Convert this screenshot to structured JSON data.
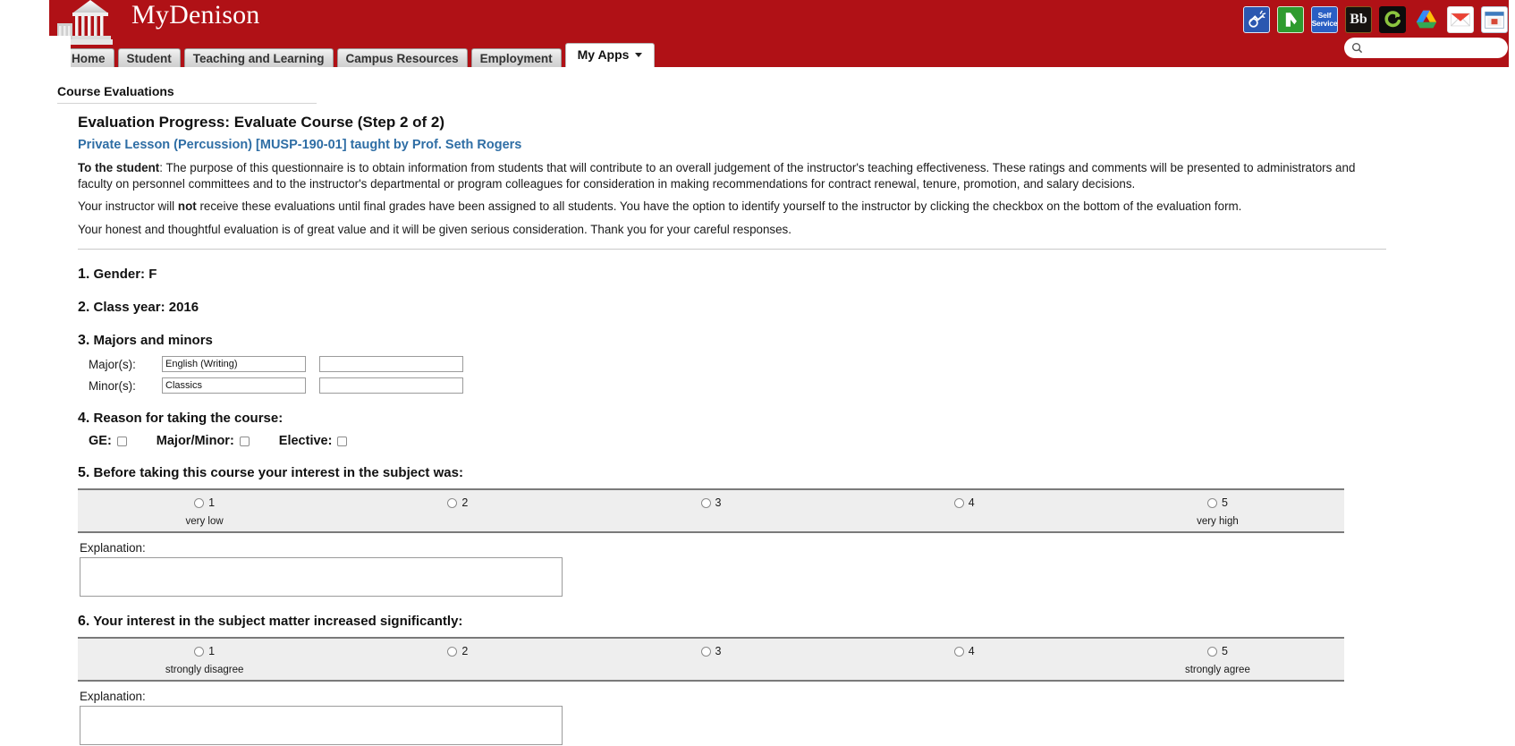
{
  "header": {
    "logo_text": "MyDenison",
    "brand_color": "#b01116",
    "app_icons": [
      {
        "name": "handshake-icon",
        "label": ""
      },
      {
        "name": "moodle-icon",
        "label": ""
      },
      {
        "name": "self-service-icon",
        "label": "Self Service"
      },
      {
        "name": "blackboard-icon",
        "label": "Bb"
      },
      {
        "name": "canvas-icon",
        "label": ""
      },
      {
        "name": "google-drive-icon",
        "label": ""
      },
      {
        "name": "gmail-icon",
        "label": ""
      },
      {
        "name": "calendar-icon",
        "label": ""
      }
    ],
    "search": {
      "value": "",
      "placeholder": ""
    }
  },
  "tabs": [
    {
      "label": "Home",
      "active": false
    },
    {
      "label": "Student",
      "active": false
    },
    {
      "label": "Teaching and Learning",
      "active": false
    },
    {
      "label": "Campus Resources",
      "active": false
    },
    {
      "label": "Employment",
      "active": false
    },
    {
      "label": "My Apps",
      "active": true
    }
  ],
  "breadcrumb": "Course Evaluations",
  "form": {
    "heading": "Evaluation Progress: Evaluate Course (Step 2 of 2)",
    "course_line": "Private Lesson (Percussion) [MUSP-190-01] taught by Prof. Seth Rogers",
    "intro_bold": "To the student",
    "intro_p1": ": The purpose of this questionnaire is to obtain information from students that will contribute to an overall judgement of the instructor's teaching effectiveness. These ratings and comments will be presented to administrators and faculty on personnel committees and to the instructor's departmental or program colleagues for consideration in making recommendations for contract renewal, tenure, promotion, and salary decisions.",
    "intro_p2_a": "Your instructor will ",
    "intro_p2_bold": "not",
    "intro_p2_b": " receive these evaluations until final grades have been assigned to all students. You have the option to identify yourself to the instructor by clicking the checkbox on the bottom of the evaluation form.",
    "intro_p3": "Your honest and thoughtful evaluation is of great value and it will be given serious consideration. Thank you for your careful responses."
  },
  "questions": {
    "q1": {
      "number": "1.",
      "text": "Gender: F"
    },
    "q2": {
      "number": "2.",
      "text": "Class year: 2016"
    },
    "q3": {
      "number": "3.",
      "text": "Majors and minors",
      "major_label": "Major(s):",
      "major_value_1": "English (Writing)",
      "major_value_2": "",
      "minor_label": "Minor(s):",
      "minor_value_1": "Classics",
      "minor_value_2": ""
    },
    "q4": {
      "number": "4.",
      "text": "Reason for taking the course:",
      "options": [
        {
          "label": "GE:",
          "checked": false
        },
        {
          "label": "Major/Minor:",
          "checked": false
        },
        {
          "label": "Elective:",
          "checked": false
        }
      ]
    },
    "q5": {
      "number": "5.",
      "text": "Before taking this course your interest in the subject was:",
      "scale": [
        {
          "value": "1",
          "anchor": "very low",
          "selected": false
        },
        {
          "value": "2",
          "anchor": "",
          "selected": false
        },
        {
          "value": "3",
          "anchor": "",
          "selected": false
        },
        {
          "value": "4",
          "anchor": "",
          "selected": false
        },
        {
          "value": "5",
          "anchor": "very high",
          "selected": false
        }
      ],
      "explanation_label": "Explanation:",
      "explanation_value": ""
    },
    "q6": {
      "number": "6.",
      "text": "Your interest in the subject matter increased significantly:",
      "scale": [
        {
          "value": "1",
          "anchor": "strongly disagree",
          "selected": false
        },
        {
          "value": "2",
          "anchor": "",
          "selected": false
        },
        {
          "value": "3",
          "anchor": "",
          "selected": false
        },
        {
          "value": "4",
          "anchor": "",
          "selected": false
        },
        {
          "value": "5",
          "anchor": "strongly agree",
          "selected": false
        }
      ],
      "explanation_label": "Explanation:",
      "explanation_value": ""
    }
  }
}
